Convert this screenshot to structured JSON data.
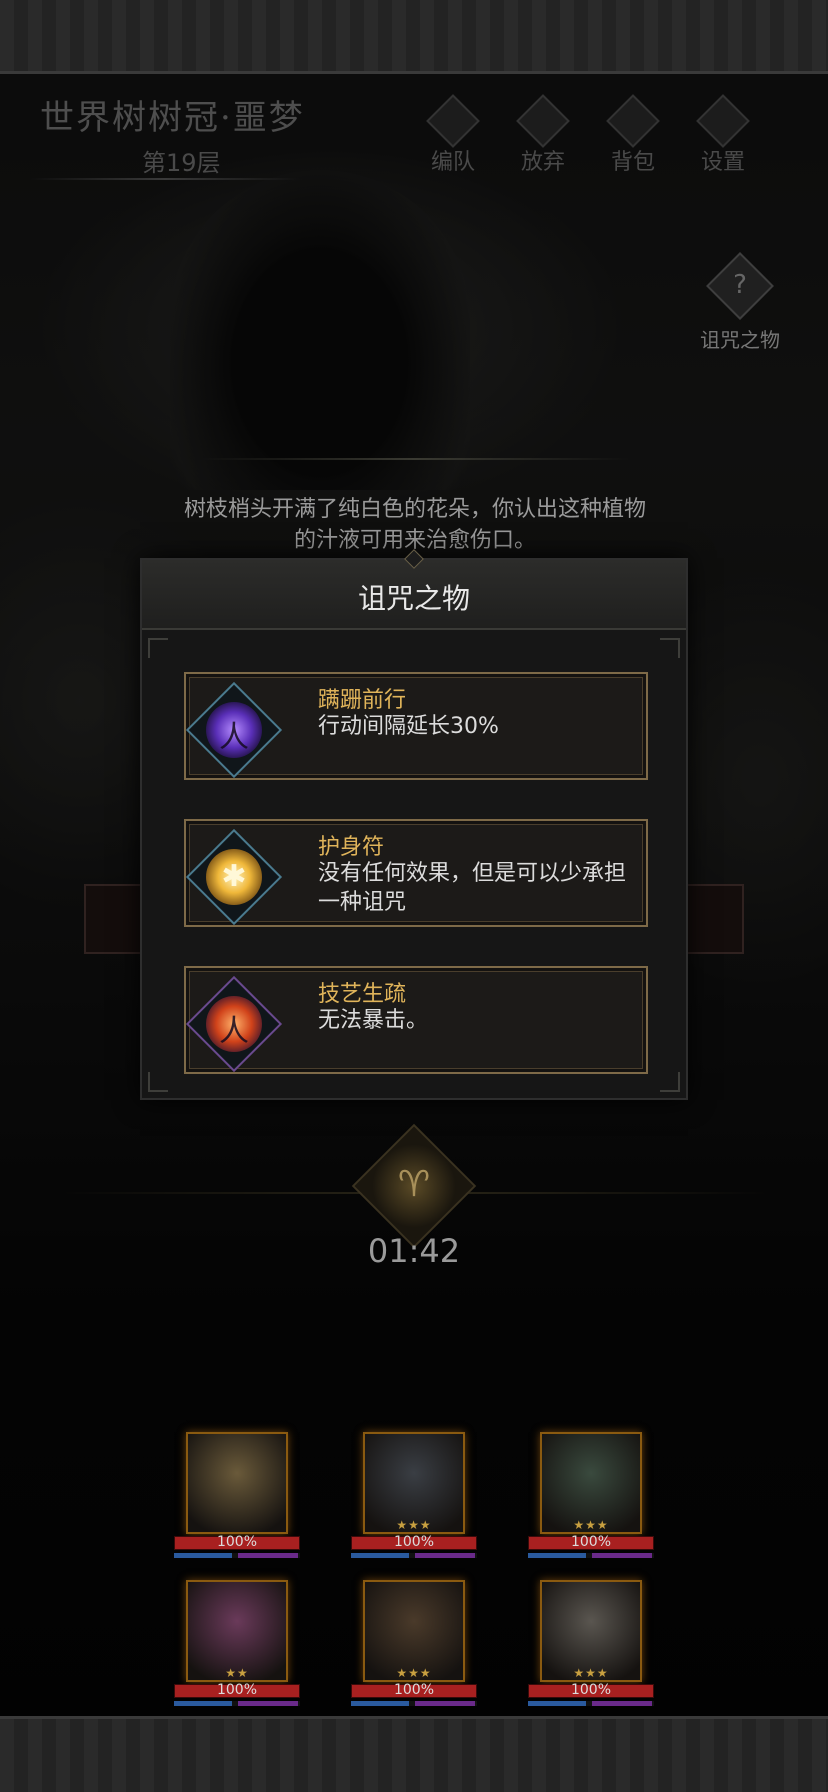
{
  "header": {
    "dungeon_title": "世界树树冠·噩梦",
    "floor": "第19层",
    "buttons": [
      {
        "label": "编队",
        "icon": "formation-icon"
      },
      {
        "label": "放弃",
        "icon": "flag-icon"
      },
      {
        "label": "背包",
        "icon": "backpack-icon"
      },
      {
        "label": "设置",
        "icon": "gear-icon"
      }
    ]
  },
  "side": {
    "curse_button_label": "诅咒之物",
    "curse_button_glyph": "?"
  },
  "story": {
    "line1": "树枝梢头开满了纯白色的花朵，你认出这种植物",
    "line2": "的汁液可用来治愈伤口。"
  },
  "curse_panel": {
    "title": "诅咒之物",
    "items": [
      {
        "name": "蹒跚前行",
        "desc": "行动间隔延长30%",
        "icon": "stumbling-figure-icon",
        "glyph": "人"
      },
      {
        "name": "护身符",
        "desc": "没有任何效果，但是可以少承担一种诅咒",
        "icon": "amulet-shield-icon",
        "glyph": "✱"
      },
      {
        "name": "技艺生疏",
        "desc": "无法暴击。",
        "icon": "burning-figure-icon",
        "glyph": "人"
      }
    ]
  },
  "timer": {
    "value": "01:42",
    "emblem_icon": "hexagram-beast-icon",
    "emblem_glyph": "♈"
  },
  "party": [
    {
      "hp": "100%",
      "hp_fraction": 1.0,
      "stars": "",
      "portrait_color": "#6a5a3a"
    },
    {
      "hp": "100%",
      "hp_fraction": 1.0,
      "stars": "★★★",
      "portrait_color": "#3a3e44"
    },
    {
      "hp": "100%",
      "hp_fraction": 1.0,
      "stars": "★★★",
      "portrait_color": "#3a4a3e"
    },
    {
      "hp": "100%",
      "hp_fraction": 1.0,
      "stars": "★★",
      "portrait_color": "#6a3a5a"
    },
    {
      "hp": "100%",
      "hp_fraction": 1.0,
      "stars": "★★★",
      "portrait_color": "#4a3a2a"
    },
    {
      "hp": "100%",
      "hp_fraction": 1.0,
      "stars": "★★★",
      "portrait_color": "#5a5650"
    }
  ],
  "colors": {
    "accent_gold": "#e0b45a",
    "card_border": "#7e6a48",
    "hp_bar": "#a82020"
  }
}
